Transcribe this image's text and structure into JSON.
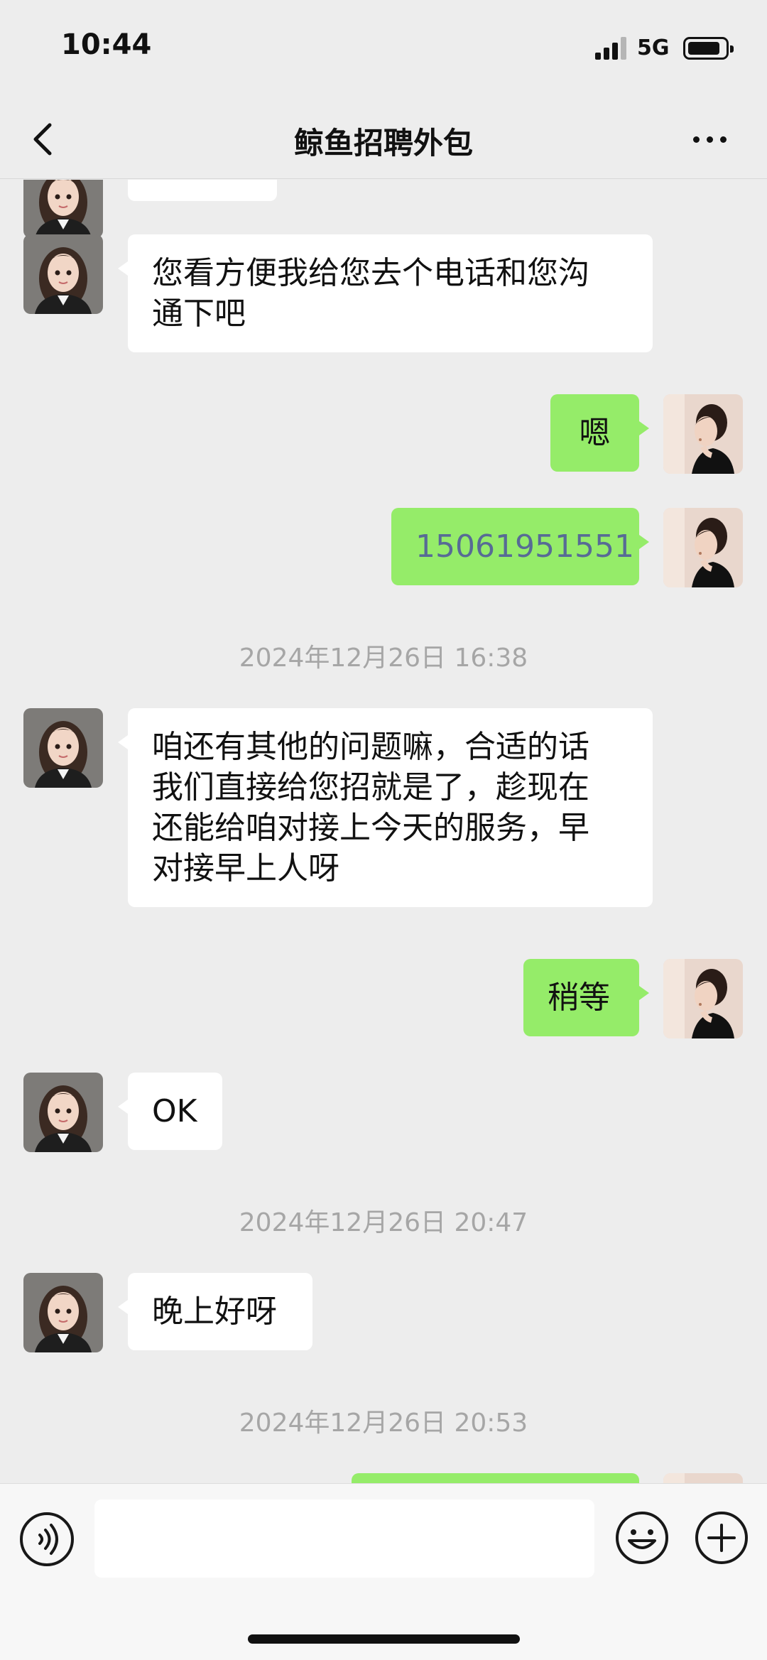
{
  "status_bar": {
    "time": "10:44",
    "network": "5G"
  },
  "nav": {
    "title": "鲸鱼招聘外包"
  },
  "messages": [
    {
      "text": "您看方便我给您去个电话和您沟\n通下吧"
    },
    {
      "text": "嗯"
    },
    {
      "text": "15061951551"
    },
    {
      "text": "咱还有其他的问题嘛，合适的话\n我们直接给您招就是了，趁现在\n还能给咱对接上今天的服务，早\n对接早上人呀"
    },
    {
      "text": "稍等"
    },
    {
      "text": "OK"
    },
    {
      "text": "晚上好呀"
    }
  ],
  "timestamps": [
    "2024年12月26日 16:38",
    "2024年12月26日 20:47",
    "2024年12月26日 20:53"
  ],
  "input": {
    "value": ""
  },
  "colors": {
    "background": "#ededed",
    "bubble_out": "#95ec69",
    "bubble_in": "#ffffff",
    "phone_link": "#576b95",
    "timestamp": "#a6a6a6"
  },
  "icons": [
    "back-icon",
    "more-icon",
    "voice-icon",
    "emoji-icon",
    "plus-icon"
  ]
}
